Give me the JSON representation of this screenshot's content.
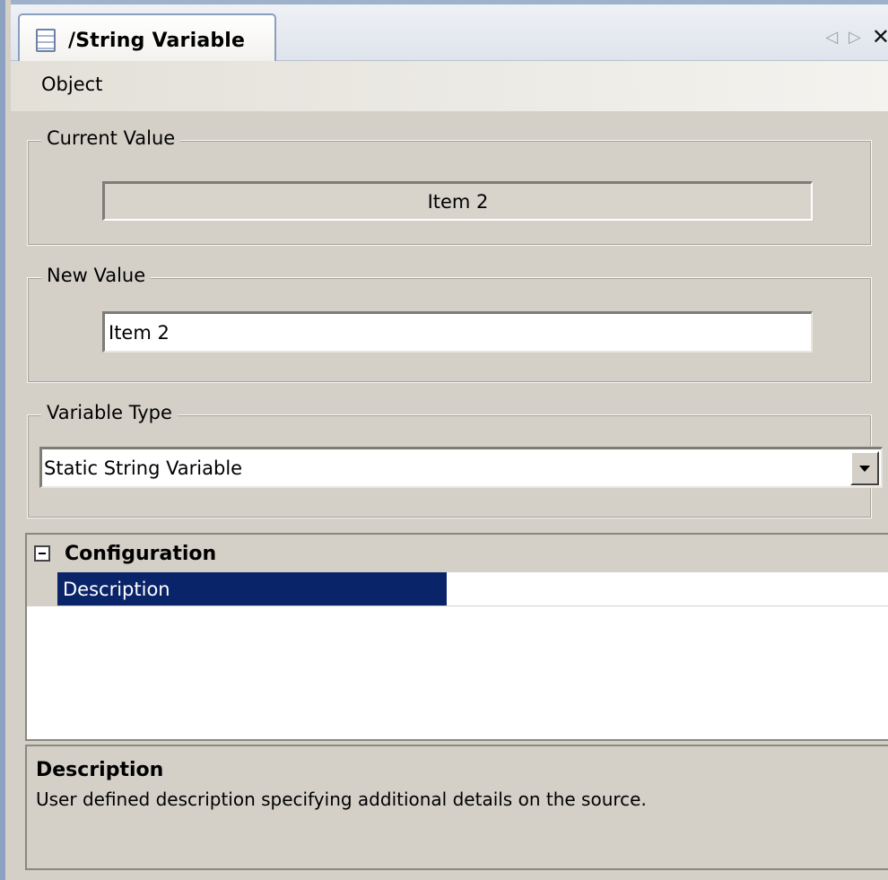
{
  "tab": {
    "title": "/String Variable",
    "icon": "document-list-icon"
  },
  "nav": {
    "prev": "◁",
    "next": "▷",
    "close": "✕"
  },
  "menu": {
    "object_label": "Object"
  },
  "current_value": {
    "legend": "Current Value",
    "value": "Item 2"
  },
  "new_value": {
    "legend": "New Value",
    "value": "Item 2"
  },
  "variable_type": {
    "legend": "Variable Type",
    "selected": "Static String Variable"
  },
  "property_grid": {
    "category": "Configuration",
    "rows": [
      {
        "name": "Description",
        "value": ""
      }
    ]
  },
  "description_pane": {
    "title": "Description",
    "text": "User defined description specifying additional details on the source."
  },
  "colors": {
    "selection": "#0a246a",
    "face": "#d4d0c8",
    "tab_border": "#8aa0bf"
  }
}
